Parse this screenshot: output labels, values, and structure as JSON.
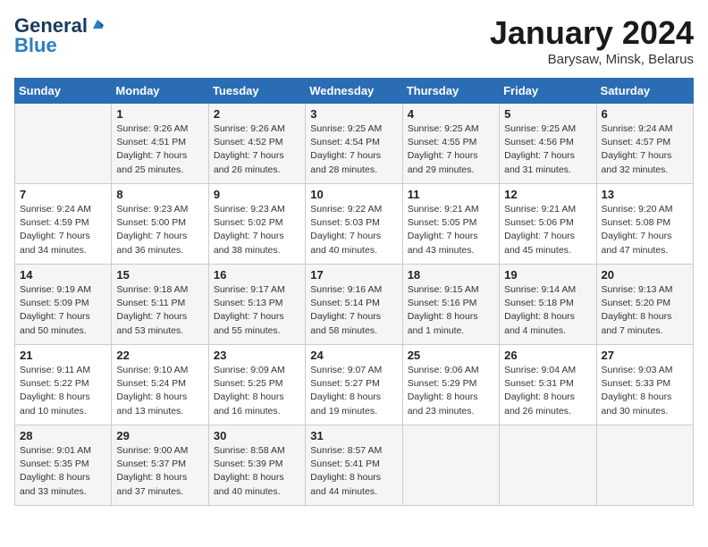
{
  "logo": {
    "line1": "General",
    "line2": "Blue"
  },
  "title": "January 2024",
  "subtitle": "Barysaw, Minsk, Belarus",
  "days_of_week": [
    "Sunday",
    "Monday",
    "Tuesday",
    "Wednesday",
    "Thursday",
    "Friday",
    "Saturday"
  ],
  "weeks": [
    [
      {
        "day": "",
        "info": ""
      },
      {
        "day": "1",
        "info": "Sunrise: 9:26 AM\nSunset: 4:51 PM\nDaylight: 7 hours\nand 25 minutes."
      },
      {
        "day": "2",
        "info": "Sunrise: 9:26 AM\nSunset: 4:52 PM\nDaylight: 7 hours\nand 26 minutes."
      },
      {
        "day": "3",
        "info": "Sunrise: 9:25 AM\nSunset: 4:54 PM\nDaylight: 7 hours\nand 28 minutes."
      },
      {
        "day": "4",
        "info": "Sunrise: 9:25 AM\nSunset: 4:55 PM\nDaylight: 7 hours\nand 29 minutes."
      },
      {
        "day": "5",
        "info": "Sunrise: 9:25 AM\nSunset: 4:56 PM\nDaylight: 7 hours\nand 31 minutes."
      },
      {
        "day": "6",
        "info": "Sunrise: 9:24 AM\nSunset: 4:57 PM\nDaylight: 7 hours\nand 32 minutes."
      }
    ],
    [
      {
        "day": "7",
        "info": "Sunrise: 9:24 AM\nSunset: 4:59 PM\nDaylight: 7 hours\nand 34 minutes."
      },
      {
        "day": "8",
        "info": "Sunrise: 9:23 AM\nSunset: 5:00 PM\nDaylight: 7 hours\nand 36 minutes."
      },
      {
        "day": "9",
        "info": "Sunrise: 9:23 AM\nSunset: 5:02 PM\nDaylight: 7 hours\nand 38 minutes."
      },
      {
        "day": "10",
        "info": "Sunrise: 9:22 AM\nSunset: 5:03 PM\nDaylight: 7 hours\nand 40 minutes."
      },
      {
        "day": "11",
        "info": "Sunrise: 9:21 AM\nSunset: 5:05 PM\nDaylight: 7 hours\nand 43 minutes."
      },
      {
        "day": "12",
        "info": "Sunrise: 9:21 AM\nSunset: 5:06 PM\nDaylight: 7 hours\nand 45 minutes."
      },
      {
        "day": "13",
        "info": "Sunrise: 9:20 AM\nSunset: 5:08 PM\nDaylight: 7 hours\nand 47 minutes."
      }
    ],
    [
      {
        "day": "14",
        "info": "Sunrise: 9:19 AM\nSunset: 5:09 PM\nDaylight: 7 hours\nand 50 minutes."
      },
      {
        "day": "15",
        "info": "Sunrise: 9:18 AM\nSunset: 5:11 PM\nDaylight: 7 hours\nand 53 minutes."
      },
      {
        "day": "16",
        "info": "Sunrise: 9:17 AM\nSunset: 5:13 PM\nDaylight: 7 hours\nand 55 minutes."
      },
      {
        "day": "17",
        "info": "Sunrise: 9:16 AM\nSunset: 5:14 PM\nDaylight: 7 hours\nand 58 minutes."
      },
      {
        "day": "18",
        "info": "Sunrise: 9:15 AM\nSunset: 5:16 PM\nDaylight: 8 hours\nand 1 minute."
      },
      {
        "day": "19",
        "info": "Sunrise: 9:14 AM\nSunset: 5:18 PM\nDaylight: 8 hours\nand 4 minutes."
      },
      {
        "day": "20",
        "info": "Sunrise: 9:13 AM\nSunset: 5:20 PM\nDaylight: 8 hours\nand 7 minutes."
      }
    ],
    [
      {
        "day": "21",
        "info": "Sunrise: 9:11 AM\nSunset: 5:22 PM\nDaylight: 8 hours\nand 10 minutes."
      },
      {
        "day": "22",
        "info": "Sunrise: 9:10 AM\nSunset: 5:24 PM\nDaylight: 8 hours\nand 13 minutes."
      },
      {
        "day": "23",
        "info": "Sunrise: 9:09 AM\nSunset: 5:25 PM\nDaylight: 8 hours\nand 16 minutes."
      },
      {
        "day": "24",
        "info": "Sunrise: 9:07 AM\nSunset: 5:27 PM\nDaylight: 8 hours\nand 19 minutes."
      },
      {
        "day": "25",
        "info": "Sunrise: 9:06 AM\nSunset: 5:29 PM\nDaylight: 8 hours\nand 23 minutes."
      },
      {
        "day": "26",
        "info": "Sunrise: 9:04 AM\nSunset: 5:31 PM\nDaylight: 8 hours\nand 26 minutes."
      },
      {
        "day": "27",
        "info": "Sunrise: 9:03 AM\nSunset: 5:33 PM\nDaylight: 8 hours\nand 30 minutes."
      }
    ],
    [
      {
        "day": "28",
        "info": "Sunrise: 9:01 AM\nSunset: 5:35 PM\nDaylight: 8 hours\nand 33 minutes."
      },
      {
        "day": "29",
        "info": "Sunrise: 9:00 AM\nSunset: 5:37 PM\nDaylight: 8 hours\nand 37 minutes."
      },
      {
        "day": "30",
        "info": "Sunrise: 8:58 AM\nSunset: 5:39 PM\nDaylight: 8 hours\nand 40 minutes."
      },
      {
        "day": "31",
        "info": "Sunrise: 8:57 AM\nSunset: 5:41 PM\nDaylight: 8 hours\nand 44 minutes."
      },
      {
        "day": "",
        "info": ""
      },
      {
        "day": "",
        "info": ""
      },
      {
        "day": "",
        "info": ""
      }
    ]
  ]
}
